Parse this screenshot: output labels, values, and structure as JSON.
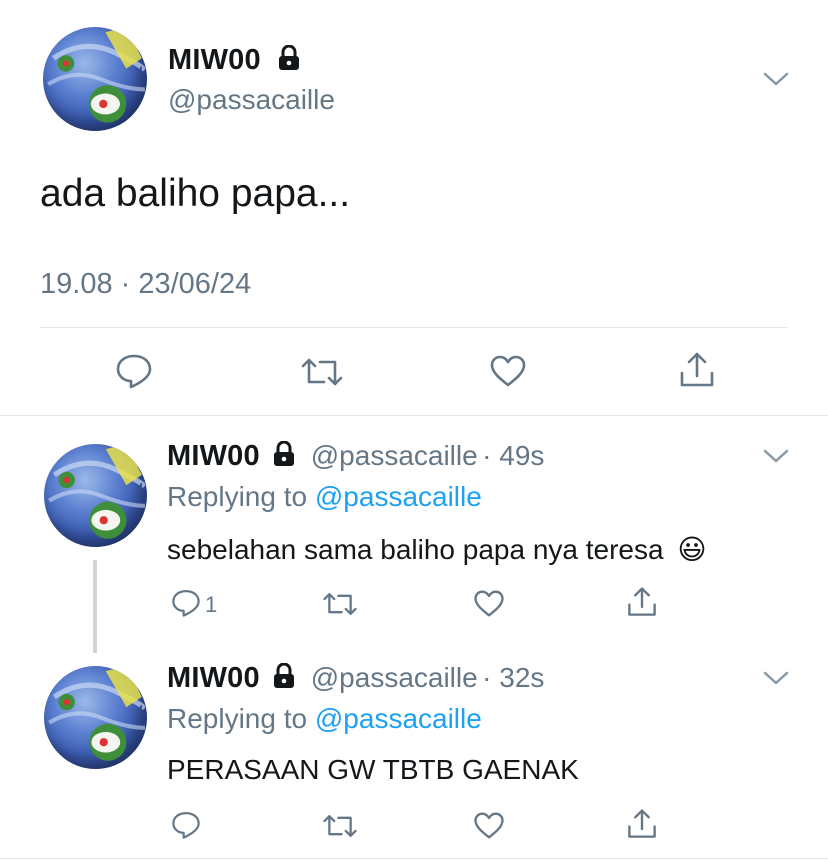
{
  "main_tweet": {
    "display_name": "MIW00",
    "handle": "@passacaille",
    "text": "ada baliho papa...",
    "timestamp": "19.08 · 23/06/24"
  },
  "replies": [
    {
      "display_name": "MIW00",
      "handle": "@passacaille",
      "age": "· 49s",
      "replying_prefix": "Replying to ",
      "replying_to": "@passacaille",
      "text": "sebelahan sama baliho papa nya teresa",
      "emoji": "😃",
      "reply_count": "1"
    },
    {
      "display_name": "MIW00",
      "handle": "@passacaille",
      "age": "· 32s",
      "replying_prefix": "Replying to ",
      "replying_to": "@passacaille",
      "text": "PERASAAN GW TBTB GAENAK",
      "reply_count": ""
    }
  ],
  "icons": {
    "lock": "lock-icon",
    "chevron": "chevron-down-icon",
    "reply": "reply-icon",
    "retweet": "retweet-icon",
    "like": "heart-icon",
    "share": "share-icon"
  },
  "colors": {
    "text": "#14171a",
    "muted": "#657786",
    "link": "#1da1f2",
    "divider": "#e1e8ed"
  }
}
